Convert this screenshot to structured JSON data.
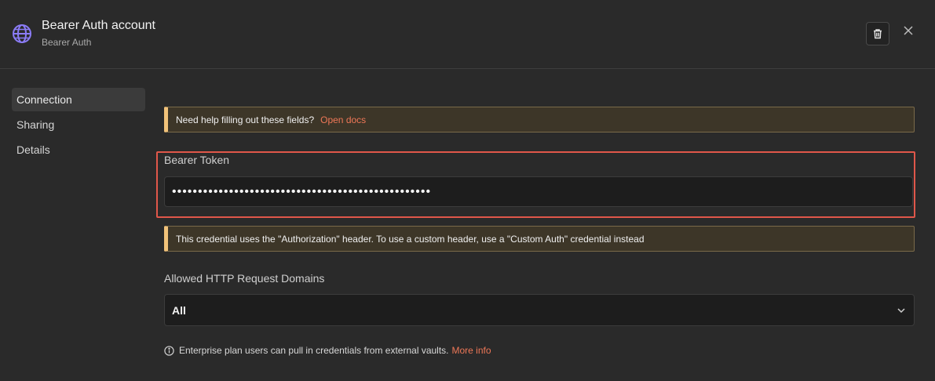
{
  "header": {
    "title": "Bearer Auth account",
    "subtitle": "Bearer Auth",
    "icon": "globe-icon",
    "accent_color": "#8b7cf6"
  },
  "sidebar": {
    "items": [
      {
        "label": "Connection",
        "active": true
      },
      {
        "label": "Sharing",
        "active": false
      },
      {
        "label": "Details",
        "active": false
      }
    ]
  },
  "help_notice": {
    "text": "Need help filling out these fields?",
    "link": "Open docs"
  },
  "bearer_token": {
    "label": "Bearer Token",
    "value": "••••••••••••••••••••••••••••••••••••••••••••••••••"
  },
  "auth_notice": {
    "text": "This credential uses the \"Authorization\" header. To use a custom header, use a \"Custom Auth\" credential instead"
  },
  "allowed_domains": {
    "label": "Allowed HTTP Request Domains",
    "selected": "All"
  },
  "footnote": {
    "text": "Enterprise plan users can pull in credentials from external vaults.",
    "link": "More info"
  },
  "colors": {
    "link": "#ee7757",
    "highlight_border": "#e0574a",
    "notice_accent": "#f1c27a"
  }
}
